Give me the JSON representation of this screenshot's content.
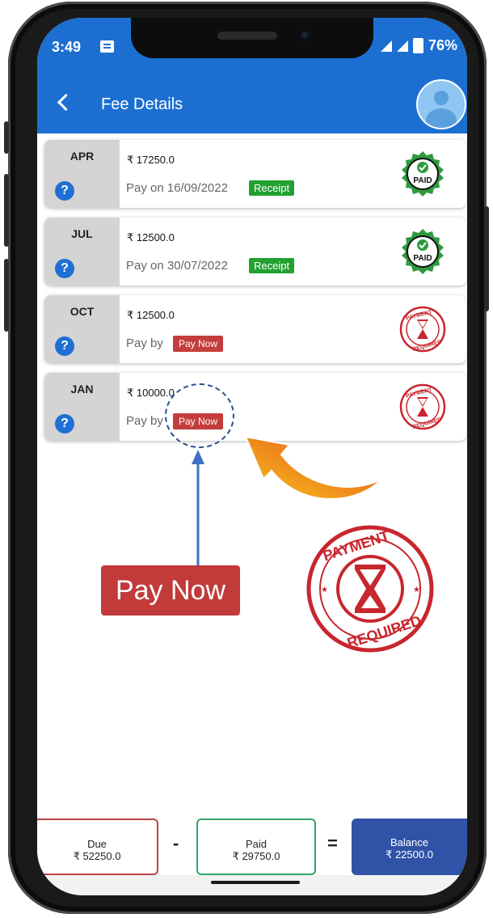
{
  "status_bar": {
    "time": "3:49",
    "battery": "76%"
  },
  "header": {
    "title": "Fee Details"
  },
  "fees": [
    {
      "month": "APR",
      "amount": "₹ 17250.0",
      "pay_text": "Pay on 16/09/2022",
      "action": "Receipt",
      "status": "paid"
    },
    {
      "month": "JUL",
      "amount": "₹ 12500.0",
      "pay_text": "Pay on 30/07/2022",
      "action": "Receipt",
      "status": "paid"
    },
    {
      "month": "OCT",
      "amount": "₹ 12500.0",
      "pay_text": "Pay by",
      "action": "Pay Now",
      "status": "payment-required"
    },
    {
      "month": "JAN",
      "amount": "₹ 10000.0",
      "pay_text": "Pay by",
      "action": "Pay Now",
      "status": "payment-required"
    }
  ],
  "stamps": {
    "paid": "PAID",
    "required_top": "PAYMENT",
    "required_bottom": "REQUIRED"
  },
  "annotation": {
    "label": "Pay Now"
  },
  "summary": {
    "due_label": "Due",
    "due_value": "₹ 52250.0",
    "minus": "-",
    "paid_label": "Paid",
    "paid_value": "₹ 29750.0",
    "equals": "=",
    "balance_label": "Balance",
    "balance_value": "₹ 22500.0"
  },
  "colors": {
    "header": "#1c6fd1",
    "receipt": "#22a030",
    "pay_now": "#c53c3c",
    "stamp_red": "#c8262e",
    "stamp_green": "#2e9a3f",
    "balance": "#3053a8"
  }
}
